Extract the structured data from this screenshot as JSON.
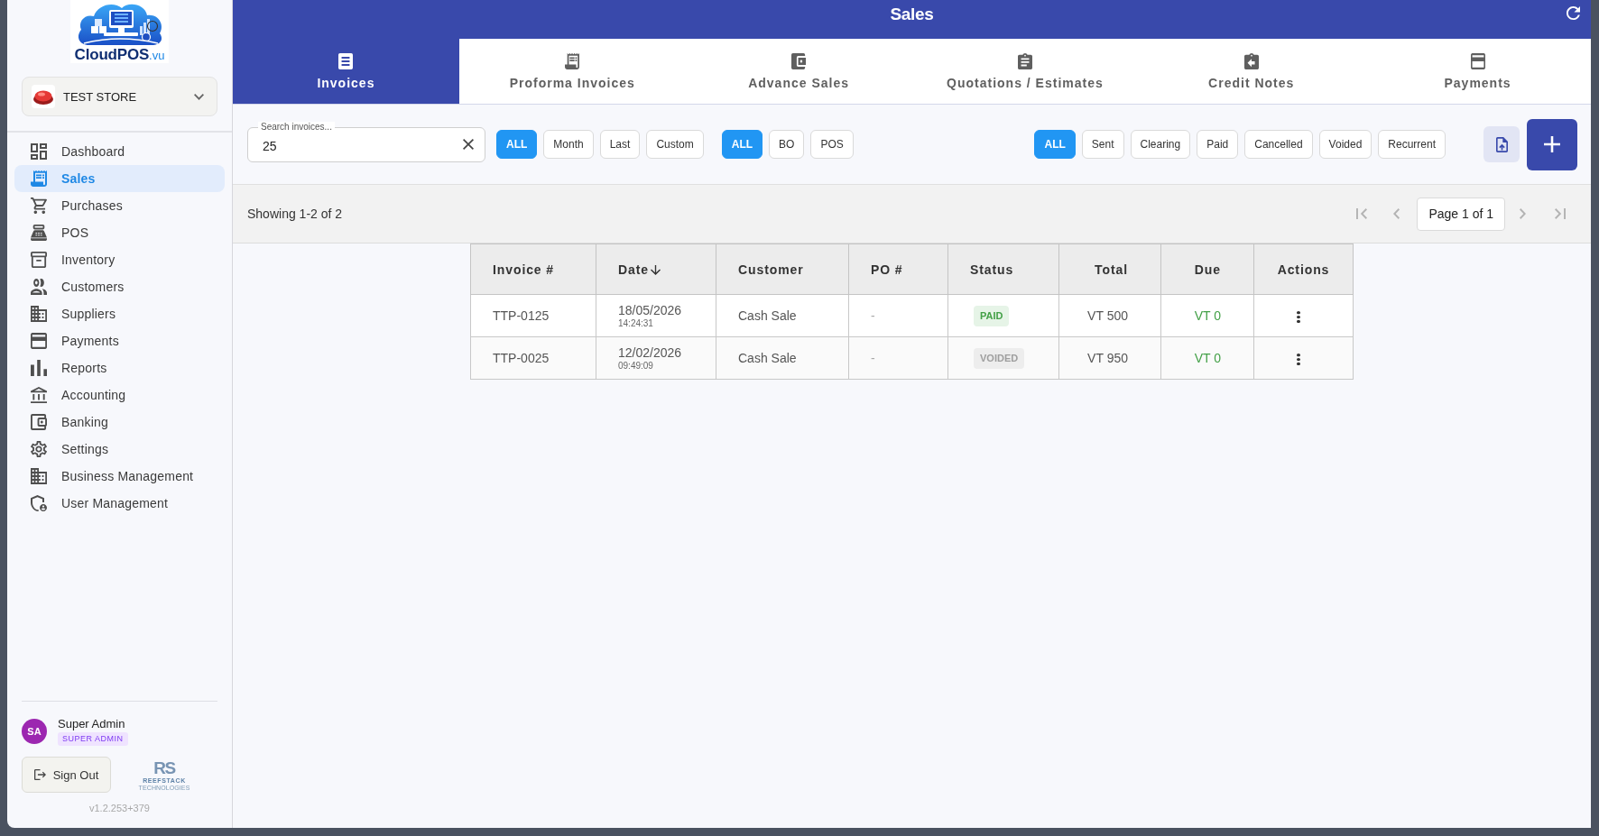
{
  "logo": {
    "name": "CloudPOS",
    "suffix": ".vu"
  },
  "store": {
    "name": "TEST STORE"
  },
  "sidebar": {
    "items": [
      {
        "label": "Dashboard",
        "selected": false
      },
      {
        "label": "Sales",
        "selected": true
      },
      {
        "label": "Purchases",
        "selected": false
      },
      {
        "label": "POS",
        "selected": false
      },
      {
        "label": "Inventory",
        "selected": false
      },
      {
        "label": "Customers",
        "selected": false
      },
      {
        "label": "Suppliers",
        "selected": false
      },
      {
        "label": "Payments",
        "selected": false
      },
      {
        "label": "Reports",
        "selected": false
      },
      {
        "label": "Accounting",
        "selected": false
      },
      {
        "label": "Banking",
        "selected": false
      },
      {
        "label": "Settings",
        "selected": false
      },
      {
        "label": "Business Management",
        "selected": false
      },
      {
        "label": "User Management",
        "selected": false
      }
    ]
  },
  "user": {
    "initials": "SA",
    "name": "Super Admin",
    "role": "SUPER ADMIN"
  },
  "sign_out": {
    "label": "Sign Out"
  },
  "company_logo": {
    "monogram": "RS",
    "name": "REEFSTACK",
    "tagline": "TECHNOLOGIES"
  },
  "version": "v1.2.253+379",
  "header": {
    "title": "Sales"
  },
  "tabs": [
    {
      "label": "Invoices",
      "selected": true
    },
    {
      "label": "Proforma Invoices",
      "selected": false
    },
    {
      "label": "Advance Sales",
      "selected": false
    },
    {
      "label": "Quotations / Estimates",
      "selected": false
    },
    {
      "label": "Credit Notes",
      "selected": false
    },
    {
      "label": "Payments",
      "selected": false
    }
  ],
  "search": {
    "label": "Search invoices...",
    "value": "25"
  },
  "filter_groups": [
    {
      "chips": [
        {
          "label": "ALL",
          "selected": true
        },
        {
          "label": "Month",
          "selected": false
        },
        {
          "label": "Last",
          "selected": false
        },
        {
          "label": "Custom",
          "selected": false
        }
      ]
    },
    {
      "chips": [
        {
          "label": "ALL",
          "selected": true
        },
        {
          "label": "BO",
          "selected": false
        },
        {
          "label": "POS",
          "selected": false
        }
      ]
    },
    {
      "chips": [
        {
          "label": "ALL",
          "selected": true
        },
        {
          "label": "Sent",
          "selected": false
        },
        {
          "label": "Clearing",
          "selected": false
        },
        {
          "label": "Paid",
          "selected": false
        },
        {
          "label": "Cancelled",
          "selected": false
        },
        {
          "label": "Voided",
          "selected": false
        },
        {
          "label": "Recurrent",
          "selected": false
        }
      ]
    }
  ],
  "pagination": {
    "summary": "Showing 1-2 of 2",
    "page": "Page 1 of 1",
    "nav_disabled": true
  },
  "table": {
    "columns": [
      {
        "label": "Invoice #",
        "sorted": false
      },
      {
        "label": "Date",
        "sorted": true
      },
      {
        "label": "Customer",
        "sorted": false
      },
      {
        "label": "PO #",
        "sorted": false
      },
      {
        "label": "Status",
        "sorted": false
      },
      {
        "label": "Total",
        "sorted": false
      },
      {
        "label": "Due",
        "sorted": false
      },
      {
        "label": "Actions",
        "sorted": false
      }
    ],
    "rows": [
      {
        "invoice": "TTP-0125",
        "date": "18/05/2026",
        "time": "14:24:31",
        "customer": "Cash Sale",
        "po": "-",
        "status": {
          "label": "PAID",
          "kind": "paid"
        },
        "total": "VT 500",
        "due": "VT 0"
      },
      {
        "invoice": "TTP-0025",
        "date": "12/02/2026",
        "time": "09:49:09",
        "customer": "Cash Sale",
        "po": "-",
        "status": {
          "label": "VOIDED",
          "kind": "voided"
        },
        "total": "VT 950",
        "due": "VT 0"
      }
    ]
  }
}
